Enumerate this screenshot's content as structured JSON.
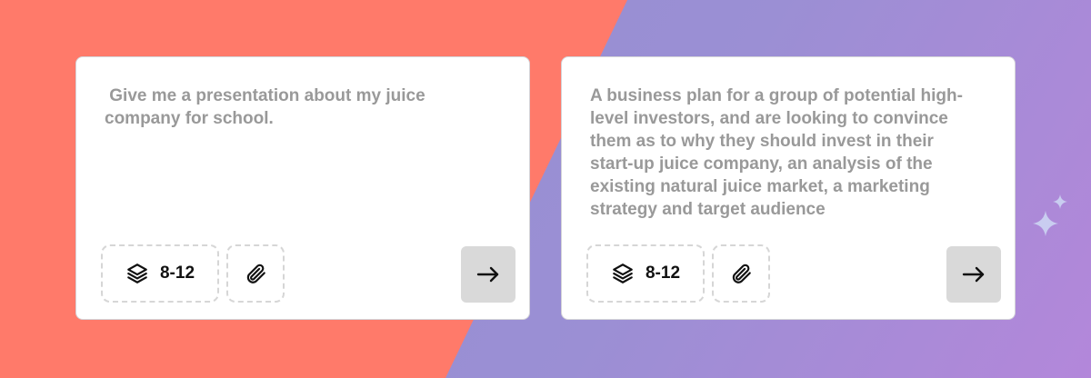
{
  "colors": {
    "coral": "#ff7a6a",
    "purple": "#9090d0",
    "card": "#ffffff",
    "prompt_text": "#999999",
    "send_bg": "#d9d9d9"
  },
  "cards": [
    {
      "prompt": " Give me a presentation about my juice\ncompany for school.",
      "slides_label": "8-12",
      "slides_icon": "layers-icon",
      "attach_icon": "paperclip-icon",
      "send_icon": "arrow-right-icon"
    },
    {
      "prompt": "A business plan for a group of potential high-\nlevel investors, and are looking to convince\nthem as to why they should invest in their\nstart-up juice company, an analysis of the\nexisting natural juice market, a marketing\nstrategy and target audience",
      "slides_label": "8-12",
      "slides_icon": "layers-icon",
      "attach_icon": "paperclip-icon",
      "send_icon": "arrow-right-icon"
    }
  ],
  "decoration": {
    "icon": "sparkles-icon"
  }
}
